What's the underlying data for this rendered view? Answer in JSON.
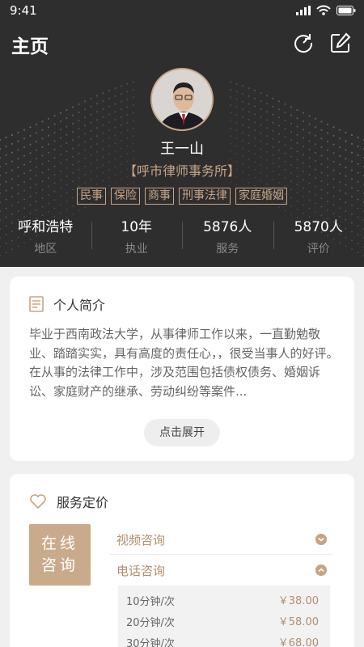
{
  "status_bar": {
    "time": "9:41"
  },
  "header": {
    "title": "主页"
  },
  "profile": {
    "name": "王一山",
    "firm": "【呼市律师事务所】",
    "tags": [
      "民事",
      "保险",
      "商事",
      "刑事法律",
      "家庭婚姻"
    ]
  },
  "stats": [
    {
      "value": "呼和浩特",
      "label": "地区"
    },
    {
      "value": "10年",
      "label": "执业"
    },
    {
      "value": "5876人",
      "label": "服务"
    },
    {
      "value": "5870人",
      "label": "评价"
    }
  ],
  "intro": {
    "title": "个人简介",
    "text": "毕业于西南政法大学，从事律师工作以来，一直勤勉敬业、踏踏实实，具有高度的责任心，，很受当事人的好评。在从事的法律工作中，涉及范围包括债权债务、婚姻诉讼、家庭财产的继承、劳动纠纷等案件...",
    "expand_label": "点击展开"
  },
  "services": {
    "title": "服务定价",
    "online_label_line1": "在线",
    "online_label_line2": "咨询",
    "options": [
      {
        "label": "视频咨询",
        "state": "collapsed"
      },
      {
        "label": "电话咨询",
        "state": "expanded"
      }
    ],
    "prices": [
      {
        "duration": "10分钟/次",
        "price": "￥38.00"
      },
      {
        "duration": "20分钟/次",
        "price": "￥58.00"
      },
      {
        "duration": "30分钟/次",
        "price": "￥68.00"
      }
    ]
  },
  "colors": {
    "accent": "#c7a584",
    "header_bg": "#2e2e2e"
  }
}
